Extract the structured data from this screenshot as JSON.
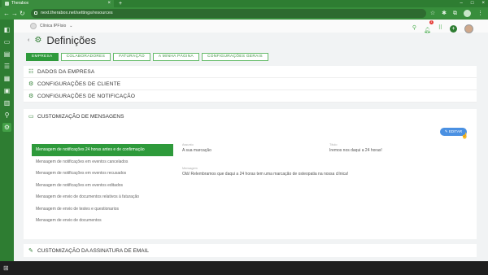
{
  "browser": {
    "tab_title": "Therabox",
    "url": "next.therabox.net/settings/resources"
  },
  "header": {
    "clinic_name": "Clínica IPFísio",
    "notification_count": "1"
  },
  "page": {
    "title": "Definições"
  },
  "tabs": [
    {
      "label": "EMPRESA",
      "active": true
    },
    {
      "label": "COLABORADORES",
      "active": false
    },
    {
      "label": "FATURAÇÃO",
      "active": false
    },
    {
      "label": "A MINHA PÁGINA",
      "active": false
    },
    {
      "label": "CONFIGURAÇÕES GERAIS",
      "active": false
    }
  ],
  "sections": {
    "company_data": "DADOS DA EMPRESA",
    "client_config": "CONFIGURAÇÕES DE CLIENTE",
    "notification_config": "CONFIGURAÇÕES DE NOTIFICAÇÃO"
  },
  "customization": {
    "title": "CUSTOMIZAÇÃO DE MENSAGENS",
    "edit_label": "EDITAR",
    "messages": [
      "Mensagem de notificações 24 horas antes e de confirmação",
      "Mensagem de notificações em eventos cancelados",
      "Mensagem de notificações em eventos recusados",
      "Mensagem de notificações em eventos editados",
      "Mensagem de envio de documentos relativos à faturação",
      "Mensagem de envio de testes e questionarios",
      "Mensagem de envio de documentos"
    ],
    "detail": {
      "subject_label": "Assunto",
      "subject_value": "A sua marcação",
      "title_label": "Título",
      "title_value": "Iremos nos daqui a 24 horas!",
      "message_label": "Mensagem",
      "message_value": "Olá! Relembramos que daqui a 24 horas tem uma marcação de osteopatia na nossa clínica!"
    }
  },
  "email_signature": {
    "title": "CUSTOMIZAÇÃO DA ASSINATURA DE EMAIL"
  },
  "colors": {
    "brand_green": "#2e7d32",
    "active_green": "#2e9a3b",
    "edit_blue": "#4a90e2"
  }
}
